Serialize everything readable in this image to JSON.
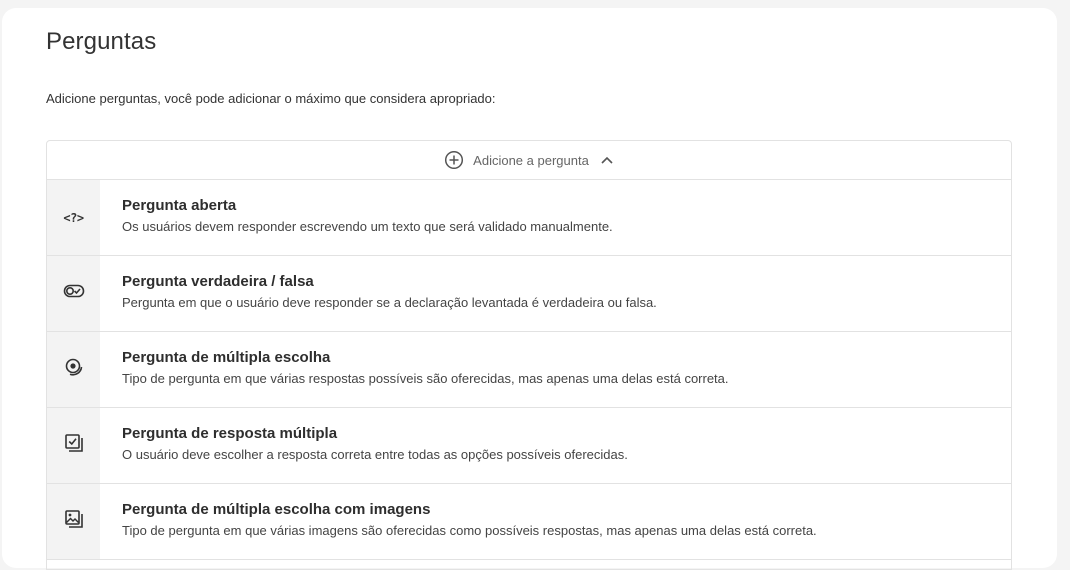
{
  "page": {
    "title": "Perguntas",
    "subtitle": "Adicione perguntas, você pode adicionar o máximo que considera apropriado:"
  },
  "add_toggle": {
    "label": "Adicione a pergunta",
    "icon": "plus-circle-icon",
    "state_icon": "chevron-up-icon"
  },
  "question_types": [
    {
      "icon": "question-code-icon",
      "glyph": "<?>",
      "title": "Pergunta aberta",
      "description": "Os usuários devem responder escrevendo um texto que será validado manualmente."
    },
    {
      "icon": "toggle-true-false-icon",
      "title": "Pergunta verdadeira / falsa",
      "description": "Pergunta em que o usuário deve responder se a declaração levantada é verdadeira ou falsa."
    },
    {
      "icon": "radio-target-icon",
      "title": "Pergunta de múltipla escolha",
      "description": "Tipo de pergunta em que várias respostas possíveis são oferecidas, mas apenas uma delas está correta."
    },
    {
      "icon": "checkbox-stack-icon",
      "title": "Pergunta de resposta múltipla",
      "description": "O usuário deve escolher a resposta correta entre todas as opções possíveis oferecidas."
    },
    {
      "icon": "image-stack-icon",
      "title": "Pergunta de múltipla escolha com imagens",
      "description": "Tipo de pergunta em que várias imagens são oferecidas como possíveis respostas, mas apenas uma delas está correta."
    }
  ]
}
